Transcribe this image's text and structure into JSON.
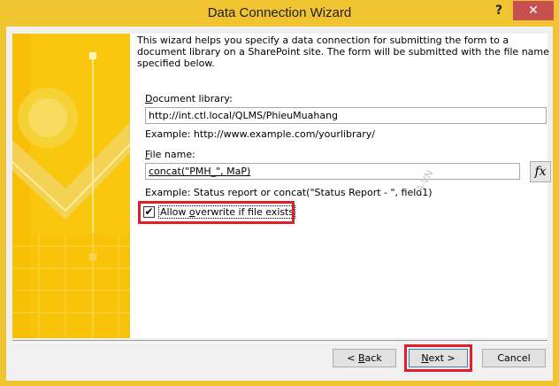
{
  "window": {
    "title": "Data Connection Wizard",
    "help_glyph": "?",
    "close_glyph": "✕"
  },
  "intro_text": "This wizard helps you specify a data connection for submitting the form to a document library on a SharePoint site. The form will be submitted with the file name specified below.",
  "document_library": {
    "label_prefix": "",
    "label_access": "D",
    "label_rest": "ocument library:",
    "value": "http://int.ctl.local/QLMS/PhieuMuahang",
    "example": "Example: http://www.example.com/yourlibrary/"
  },
  "file_name": {
    "label_access": "F",
    "label_rest": "ile name:",
    "value": "concat(\"PMH_\", MaP)",
    "example": "Example: Status report or concat(\"Status Report - \", field1)",
    "fx_label": "fx"
  },
  "overwrite": {
    "checked": true,
    "check_glyph": "✔",
    "label_pre": "Allow ",
    "label_access": "o",
    "label_rest": "verwrite if file exists"
  },
  "buttons": {
    "back_pre": "< ",
    "back_access": "B",
    "back_rest": "ack",
    "next_access": "N",
    "next_rest": "ext >",
    "cancel": "Cancel"
  },
  "watermark": "A-VN",
  "colors": {
    "banner": "#f9c70d",
    "highlight": "#e01e2c",
    "close": "#c75050"
  }
}
